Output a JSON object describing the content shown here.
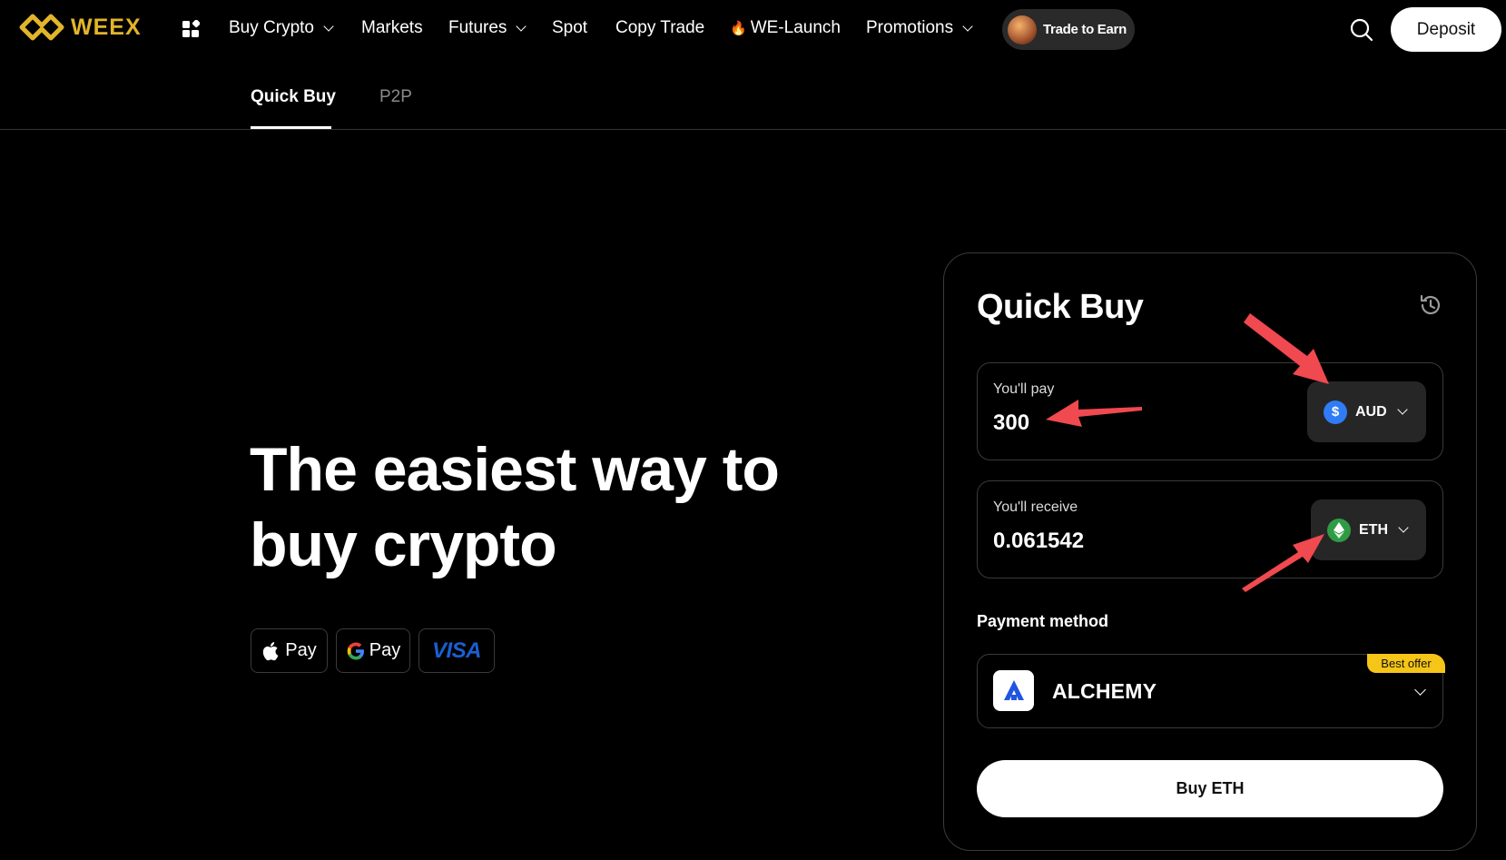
{
  "nav": {
    "brand": "WEEX",
    "items": [
      {
        "label": "Buy Crypto",
        "dropdown": true
      },
      {
        "label": "Markets",
        "dropdown": false
      },
      {
        "label": "Futures",
        "dropdown": true
      },
      {
        "label": "Spot",
        "dropdown": false
      },
      {
        "label": "Copy Trade",
        "dropdown": false
      },
      {
        "label": "WE-Launch",
        "dropdown": false,
        "icon": "fire-icon"
      },
      {
        "label": "Promotions",
        "dropdown": true
      }
    ],
    "trade_to_earn": "Trade to Earn",
    "deposit_label": "Deposit",
    "brand_color": "#e2b52a"
  },
  "tabs": {
    "active": "Quick Buy",
    "inactive": "P2P"
  },
  "hero": {
    "line1": "The easiest way to",
    "line2": "buy crypto"
  },
  "payment_logos": {
    "apple": "Pay",
    "google": "Pay",
    "visa": "VISA"
  },
  "card": {
    "title": "Quick Buy",
    "pay": {
      "label": "You'll pay",
      "amount": "300",
      "currency": "AUD",
      "currency_symbol": "$",
      "coin_color": "#2f7cf6"
    },
    "receive": {
      "label": "You'll receive",
      "amount": "0.061542",
      "currency": "ETH",
      "coin_color": "#2f9b45"
    },
    "payment_method_label": "Payment method",
    "provider": "ALCHEMY",
    "provider_badge": "Best offer",
    "buy_button": "Buy ETH"
  },
  "annotation_color": "#f0494f"
}
